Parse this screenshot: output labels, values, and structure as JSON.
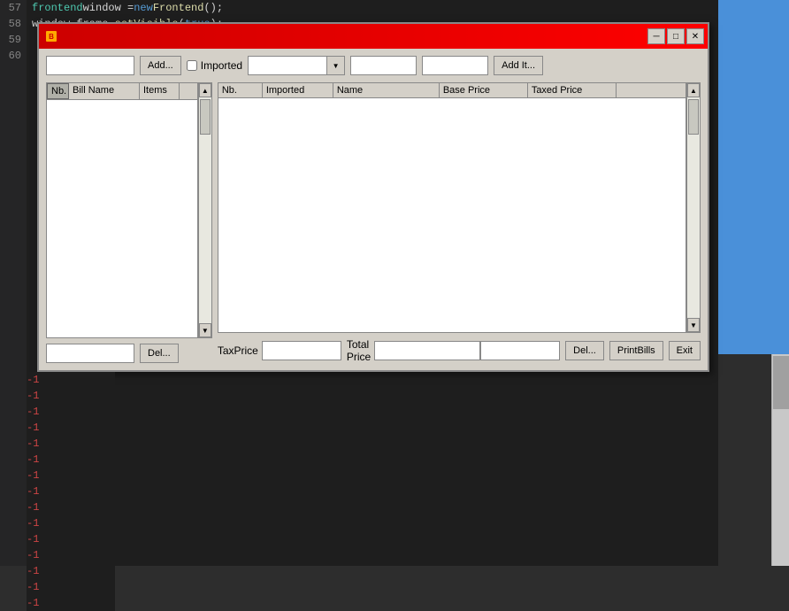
{
  "titleBar": {
    "closeLabel": "✕",
    "minimizeLabel": "─",
    "maximizeLabel": "□"
  },
  "toolbar": {
    "addButtonLabel": "Add...",
    "importedLabel": "Imported",
    "addItButtonLabel": "Add It..."
  },
  "leftTable": {
    "headers": [
      "Nb.",
      "Bill Name",
      "Items"
    ],
    "rows": []
  },
  "rightTable": {
    "headers": [
      "Nb.",
      "Imported",
      "Name",
      "Base Price",
      "Taxed Price"
    ],
    "rows": []
  },
  "bottomBar": {
    "taxPriceLabel": "TaxPrice",
    "totalPriceLabel": "Total Price",
    "delButtonLabel": "Del...",
    "printBillsLabel": "PrintBills",
    "exitLabel": "Exit"
  },
  "leftBottom": {
    "delButtonLabel": "Del..."
  },
  "codeLines": {
    "line57": "frontend window = new Frontend();",
    "line58": "window.frame.setVisible(true);"
  },
  "belowNumbers": [
    "-1",
    "-1",
    "-1",
    "-1",
    "-1",
    "-1",
    "-1",
    "-1",
    "-1",
    "-1",
    "-1",
    "-1",
    "-1",
    "-1",
    "-1"
  ]
}
